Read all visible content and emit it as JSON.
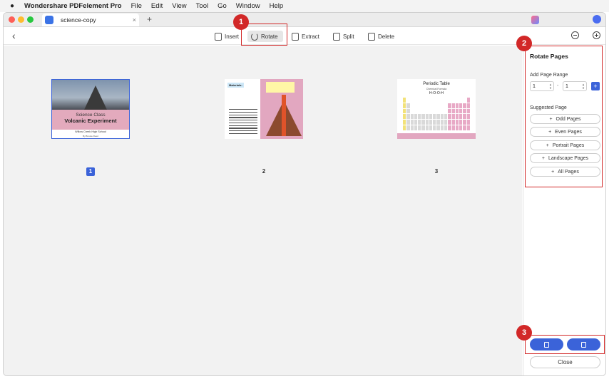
{
  "menubar": {
    "app_name": "Wondershare PDFelement Pro",
    "items": [
      "File",
      "Edit",
      "View",
      "Tool",
      "Go",
      "Window",
      "Help"
    ]
  },
  "tab": {
    "title": "science-copy",
    "close": "×",
    "new": "+"
  },
  "toolbar": {
    "insert": "Insert",
    "rotate": "Rotate",
    "extract": "Extract",
    "split": "Split",
    "delete": "Delete"
  },
  "pages": [
    {
      "number": "1",
      "selected": true,
      "title_line1": "Science Class",
      "title_line2": "Volcanic Experiment",
      "sub1": "Willow Creek High School",
      "sub2": "By Brooke Reed"
    },
    {
      "number": "2",
      "selected": false,
      "label": "Materials:"
    },
    {
      "number": "3",
      "selected": false,
      "title": "Periodic Table",
      "sub": "Chemical Formula",
      "formula": "H-O-O-H"
    }
  ],
  "panel": {
    "title": "Rotate Pages",
    "range_label": "Add Page Range",
    "range_from": "1",
    "range_to": "1",
    "range_dash": "-",
    "add": "+",
    "suggested_label": "Suggested Page",
    "suggested": [
      "Odd Pages",
      "Even Pages",
      "Portrait Pages",
      "Landscape Pages",
      "All Pages"
    ],
    "close": "Close"
  },
  "annotations": [
    "1",
    "2",
    "3"
  ],
  "colors": {
    "accent": "#3b63d9",
    "callout": "#d22828"
  }
}
